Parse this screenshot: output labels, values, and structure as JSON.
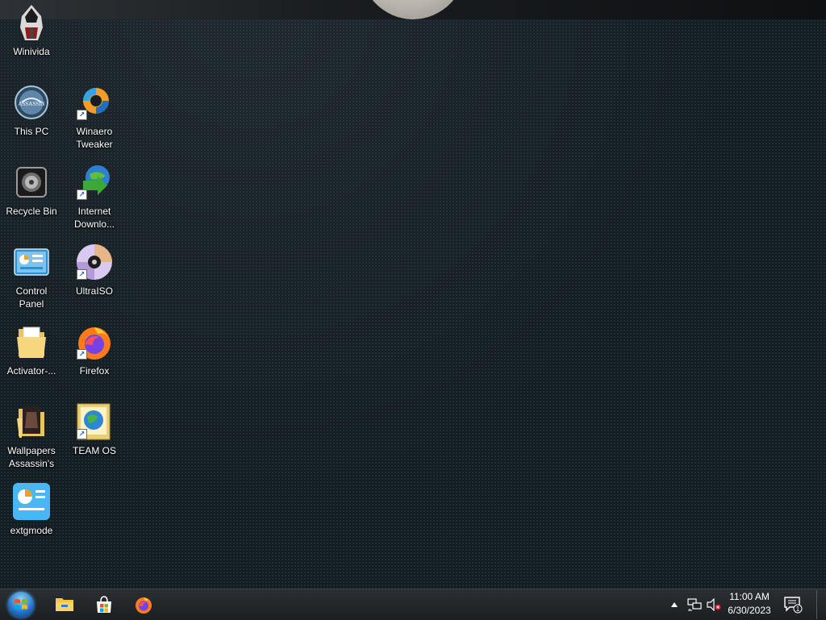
{
  "desktop": {
    "icons": [
      {
        "label": "Winivida",
        "icon": "assassin-avatar-icon"
      },
      {
        "label": "This PC",
        "icon": "this-pc-icon"
      },
      {
        "label": "Winaero\nTweaker",
        "icon": "winaero-tweaker-icon"
      },
      {
        "label": "Recycle Bin",
        "icon": "recycle-bin-icon"
      },
      {
        "label": "Internet\nDownlo...",
        "icon": "internet-download-manager-icon"
      },
      {
        "label": "Control\nPanel",
        "icon": "control-panel-icon"
      },
      {
        "label": "UltraISO",
        "icon": "ultraiso-disc-icon"
      },
      {
        "label": "Activator-...",
        "icon": "folder-icon"
      },
      {
        "label": "Firefox",
        "icon": "firefox-icon"
      },
      {
        "label": "Wallpapers\nAssassin's",
        "icon": "wallpaper-folder-icon"
      },
      {
        "label": "TEAM OS",
        "icon": "team-os-globe-icon"
      },
      {
        "label": "extgmode",
        "icon": "extgmode-icon"
      }
    ]
  },
  "taskbar": {
    "start": {
      "icon": "windows-start-orb-icon"
    },
    "pinned": [
      {
        "icon": "file-explorer-icon"
      },
      {
        "icon": "microsoft-store-icon"
      },
      {
        "icon": "firefox-icon"
      }
    ],
    "tray": {
      "overflow_icon": "chevron-up-icon",
      "network_icon": "network-icon",
      "volume_icon": "volume-muted-icon",
      "notification_icon": "action-center-icon",
      "notification_count": "1"
    },
    "clock": {
      "time": "11:00 AM",
      "date": "6/30/2023"
    }
  },
  "colors": {
    "desktop_bg": "#141d22",
    "taskbar_bg": "#1b1f22",
    "label_text": "#ffffff"
  }
}
